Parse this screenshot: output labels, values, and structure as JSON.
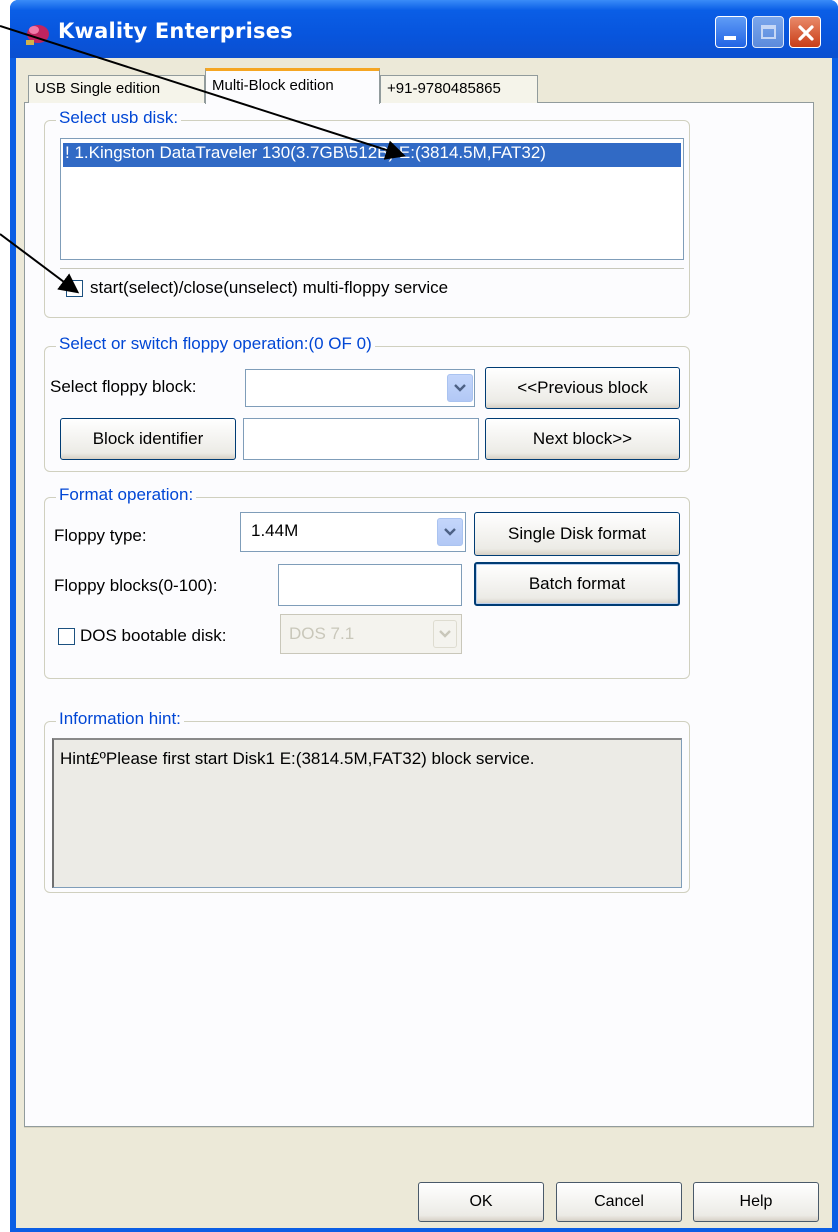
{
  "window": {
    "title": "Kwality Enterprises",
    "app_icon": "app-icon",
    "controls": [
      "minimize-icon",
      "maximize-icon",
      "close-icon"
    ]
  },
  "tabs": [
    {
      "label": "USB  Single  edition",
      "selected": false
    },
    {
      "label": "Multi-Block  edition",
      "selected": true
    },
    {
      "label": "+91-9780485865",
      "selected": false
    }
  ],
  "usb_group": {
    "legend": "Select usb disk:",
    "items": [
      "! 1.Kingston DataTraveler 130(3.7GB\\512B)  E:(3814.5M,FAT32)"
    ],
    "service_checkbox_label": "start(select)/close(unselect) multi-floppy service",
    "service_checked": false
  },
  "switch_group": {
    "legend": "Select or switch floppy operation:(0 OF 0)",
    "select_block_label": "Select floppy block:",
    "select_block_value": "",
    "prev_button": "<<Previous block",
    "identifier_button": "Block identifier",
    "identifier_value": "",
    "next_button": "Next block>>"
  },
  "format_group": {
    "legend": "Format operation:",
    "floppy_type_label": "Floppy type:",
    "floppy_type_value": "1.44M",
    "single_format_button": "Single Disk format",
    "blocks_label": "Floppy blocks(0-100):",
    "blocks_value": "",
    "batch_format_button": "Batch format",
    "dos_checkbox_label": "DOS bootable disk:",
    "dos_checked": false,
    "dos_value": "DOS 7.1"
  },
  "hint_group": {
    "legend": "Information hint:",
    "text": "Hint£ºPlease first start Disk1 E:(3814.5M,FAT32)   block service."
  },
  "footer": {
    "ok": "OK",
    "cancel": "Cancel",
    "help": "Help"
  },
  "colors": {
    "titlebar": "#0a5ee6",
    "legend": "#0046d5",
    "selection": "#316ac5",
    "dialog": "#ece9d8"
  }
}
